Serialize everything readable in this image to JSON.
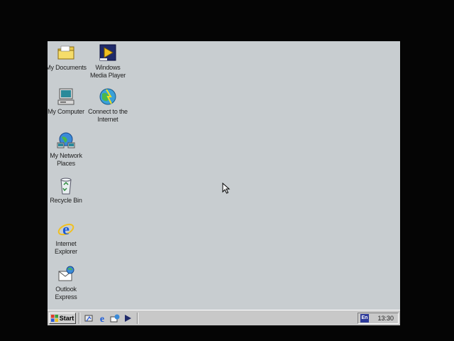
{
  "desktop": {
    "icons": [
      {
        "label": "My Documents"
      },
      {
        "label": "Windows Media Player"
      },
      {
        "label": "My Computer"
      },
      {
        "label": "Connect to the Internet"
      },
      {
        "label": "My Network Places"
      },
      {
        "label": "Recycle Bin"
      },
      {
        "label": "Internet Explorer"
      },
      {
        "label": "Outlook Express"
      }
    ],
    "background_color": "#c8cdd0"
  },
  "taskbar": {
    "start_label": "Start",
    "quick_launch": [
      "show-desktop-icon",
      "internet-explorer-icon",
      "outlook-express-icon",
      "media-player-icon"
    ],
    "tray": {
      "language": "En",
      "clock": "13:30"
    }
  }
}
